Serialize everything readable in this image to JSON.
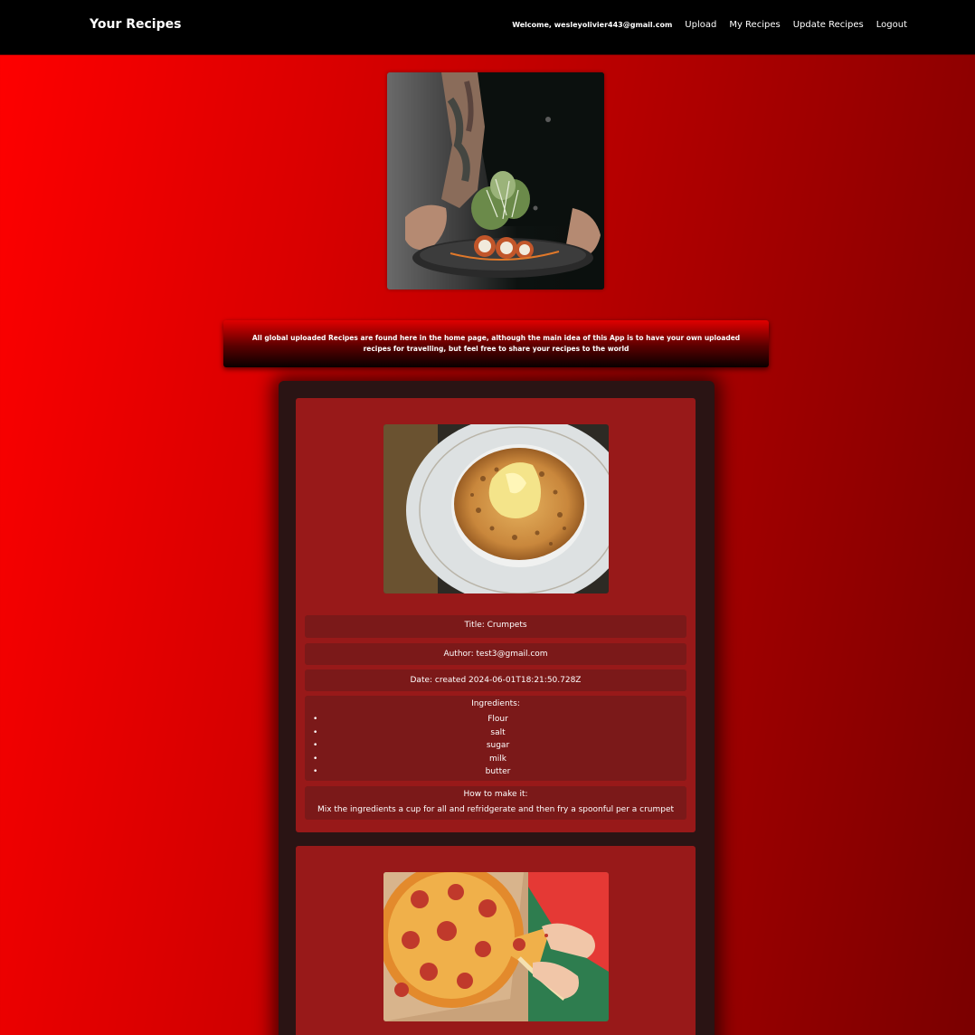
{
  "nav": {
    "brand": "Your Recipes",
    "welcome": "Welcome, wesleyolivier443@gmail.com",
    "links": [
      "Upload",
      "My Recipes",
      "Update Recipes",
      "Logout"
    ]
  },
  "banner": {
    "text": "All global uploaded Recipes are found here in the home page, although the main idea of this App is to have your own uploaded recipes for travelling, but feel free to share your recipes to the world"
  },
  "recipes": [
    {
      "title": "Title: Crumpets",
      "author": "Author: test3@gmail.com",
      "date": "Date: created 2024-06-01T18:21:50.728Z",
      "ingredients_label": "Ingredients:",
      "ingredients": [
        "Flour",
        "salt",
        "sugar",
        "milk",
        "butter"
      ],
      "howto_label": "How to make it:",
      "howto": "Mix the ingredients a cup for all and refridgerate and then fry a spoonful per a crumpet"
    }
  ],
  "colors": {
    "navbar": "#000000",
    "card": "#981919",
    "field": "#7b1919",
    "feed": "#2a1414",
    "accent": "#ff0000"
  },
  "icons": {
    "list_bullet": "bullet-icon"
  }
}
